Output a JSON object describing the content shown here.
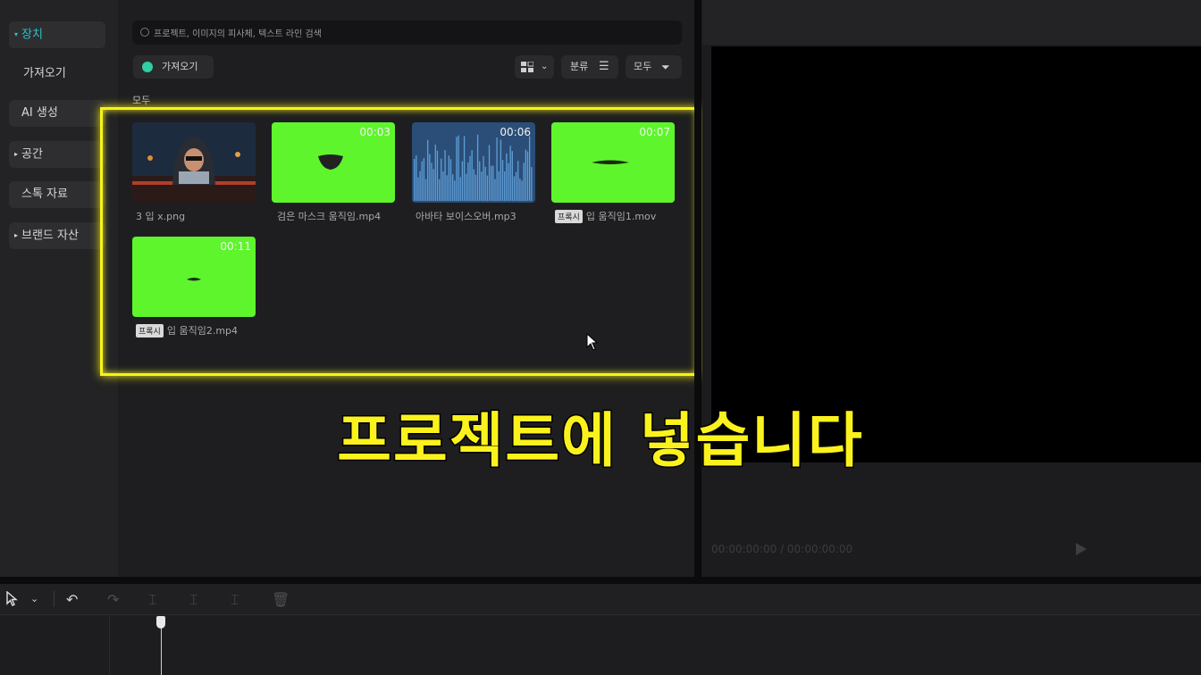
{
  "sidebar": {
    "items": [
      {
        "label": "장치",
        "expandable": true,
        "active": true
      },
      {
        "label": "가져오기",
        "expandable": false
      },
      {
        "label": "AI 생성",
        "expandable": false
      },
      {
        "label": "공간",
        "expandable": true
      },
      {
        "label": "스톡 자료",
        "expandable": false
      },
      {
        "label": "브랜드 자산",
        "expandable": true
      }
    ]
  },
  "media": {
    "search_placeholder": "프로젝트, 이미지의 피사체, 텍스트 라인 검색",
    "import_label": "가져오기",
    "sort_label": "분류",
    "filter_label": "모두",
    "section_label": "모두",
    "items": [
      {
        "name": "3 입 x.png",
        "duration": "",
        "proxy": false
      },
      {
        "name": "검은 마스크 움직임.mp4",
        "duration": "00:03",
        "proxy": false
      },
      {
        "name": "아바타 보이스오버.mp3",
        "duration": "00:06",
        "proxy": false
      },
      {
        "name": "입 움직임1.mov",
        "duration": "00:07",
        "proxy": true
      },
      {
        "name": "입 움직임2.mp4",
        "duration": "00:11",
        "proxy": true
      }
    ],
    "proxy_tag": "프록시"
  },
  "preview": {
    "timecode": "00:00:00:00 / 00:00:00:00"
  },
  "subtitle": "프로젝트에 넣습니다",
  "colors": {
    "accent": "#27c3c7",
    "highlight": "#f7f21c",
    "green_screen": "#5ef52d"
  }
}
